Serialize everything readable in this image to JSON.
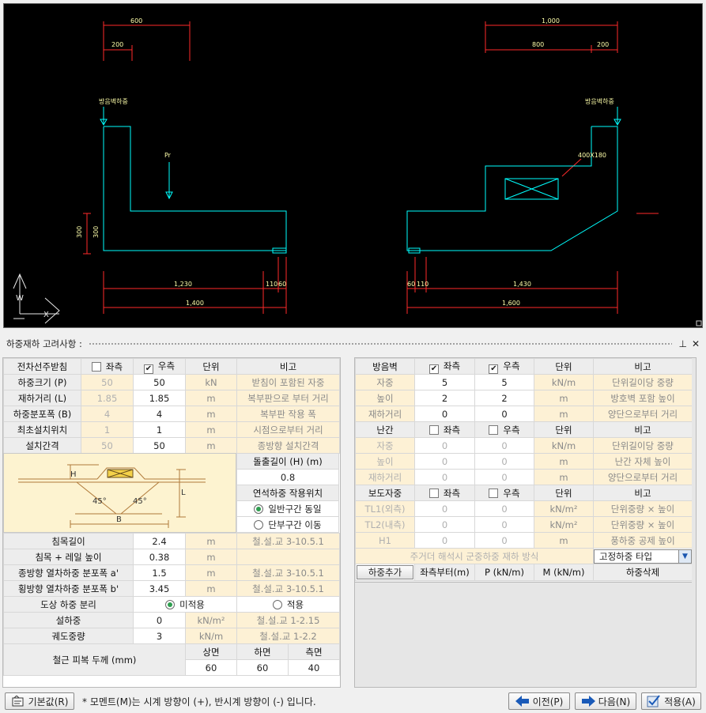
{
  "cad": {
    "left": {
      "dim_top": "600",
      "dim_sub": "200",
      "label_barrier": "방음벽하중",
      "label_pr": "Pr",
      "dim_h1": "300",
      "dim_h2": "300",
      "dim_b1": "1,230",
      "dim_b2": "110",
      "dim_b3": "60",
      "dim_total": "1,400"
    },
    "right": {
      "dim_top": "1,000",
      "dim_sub1": "800",
      "dim_sub2": "200",
      "label_barrier": "방음벽하중",
      "label_box": "400X180",
      "dim_b1": "60",
      "dim_b2": "110",
      "dim_b3": "1,430",
      "dim_total": "1,600"
    },
    "ucs": {
      "x": "X",
      "y": "Y",
      "w": "W"
    }
  },
  "panel": {
    "title": "하중재하 고려사항 :",
    "pin": "📌",
    "close": "✕"
  },
  "left": {
    "header": {
      "c1": "전차선주받침",
      "left": "좌측",
      "right": "우측",
      "unit": "단위",
      "note": "비고"
    },
    "rows": [
      {
        "label": "하중크기 (P)",
        "l": "50",
        "r": "50",
        "unit": "kN",
        "note": "받침이 포함된 자중"
      },
      {
        "label": "재하거리 (L)",
        "l": "1.85",
        "r": "1.85",
        "unit": "m",
        "note": "복부판으로 부터 거리"
      },
      {
        "label": "하중분포폭 (B)",
        "l": "4",
        "r": "4",
        "unit": "m",
        "note": "복부판 작용 폭"
      },
      {
        "label": "최초설치위치",
        "l": "1",
        "r": "1",
        "unit": "m",
        "note": "시점으로부터 거리"
      },
      {
        "label": "설치간격",
        "l": "50",
        "r": "50",
        "unit": "m",
        "note": "종방향 설치간격"
      }
    ],
    "protrusion": {
      "label": "돌출길이 (H) (m)",
      "value": "0.8"
    },
    "position": {
      "label": "연석하중 작용위치",
      "opt1": "일반구간 동일",
      "opt2": "단부구간 이동"
    },
    "diagram": {
      "h": "H",
      "l": "L",
      "b": "B",
      "angle1": "45°",
      "angle2": "45°"
    },
    "rows2": [
      {
        "label": "침목길이",
        "value": "2.4",
        "unit": "m",
        "note": "철.설.교 3-10.5.1"
      },
      {
        "label": "침목 + 레일 높이",
        "value": "0.38",
        "unit": "m",
        "note": ""
      },
      {
        "label": "종방향 열차하중 분포폭 a'",
        "value": "1.5",
        "unit": "m",
        "note": "철.설.교 3-10.5.1"
      },
      {
        "label": "횡방향 열차하중 분포폭 b'",
        "value": "3.45",
        "unit": "m",
        "note": "철.설.교 3-10.5.1"
      }
    ],
    "ballast": {
      "label": "도상 하중 분리",
      "opt1": "미적용",
      "opt2": "적용"
    },
    "rows3": [
      {
        "label": "설하중",
        "value": "0",
        "unit": "kN/m²",
        "note": "철.설.교 1-2.15"
      },
      {
        "label": "궤도중량",
        "value": "3",
        "unit": "kN/m",
        "note": "철.설.교 1-2.2"
      }
    ],
    "cover": {
      "label": "철근 피복 두께 (mm)",
      "top": "상면",
      "bottom": "하면",
      "side": "측면",
      "v_top": "60",
      "v_bottom": "60",
      "v_side": "40"
    }
  },
  "right": {
    "sec1": {
      "title": "방음벽",
      "left": "좌측",
      "right": "우측",
      "unit": "단위",
      "note": "비고"
    },
    "sec1_rows": [
      {
        "label": "자중",
        "l": "5",
        "r": "5",
        "unit": "kN/m",
        "note": "단위길이당 중량"
      },
      {
        "label": "높이",
        "l": "2",
        "r": "2",
        "unit": "m",
        "note": "방호벽 포함 높이"
      },
      {
        "label": "재하거리",
        "l": "0",
        "r": "0",
        "unit": "m",
        "note": "양단으로부터 거리"
      }
    ],
    "sec2": {
      "title": "난간",
      "left": "좌측",
      "right": "우측",
      "unit": "단위",
      "note": "비고"
    },
    "sec2_rows": [
      {
        "label": "자중",
        "l": "0",
        "r": "0",
        "unit": "kN/m",
        "note": "단위길이당 중량"
      },
      {
        "label": "높이",
        "l": "0",
        "r": "0",
        "unit": "m",
        "note": "난간 자체 높이"
      },
      {
        "label": "재하거리",
        "l": "0",
        "r": "0",
        "unit": "m",
        "note": "양단으로부터 거리"
      }
    ],
    "sec3": {
      "title": "보도자중",
      "left": "좌측",
      "right": "우측",
      "unit": "단위",
      "note": "비고"
    },
    "sec3_rows": [
      {
        "label": "TL1(외측)",
        "l": "0",
        "r": "0",
        "unit": "kN/m²",
        "note": "단위중량 × 높이"
      },
      {
        "label": "TL2(내측)",
        "l": "0",
        "r": "0",
        "unit": "kN/m²",
        "note": "단위중량 × 높이"
      },
      {
        "label": "H1",
        "l": "0",
        "r": "0",
        "unit": "m",
        "note": "풍하중 공제 높이"
      }
    ],
    "girder": {
      "label": "주거더 해석시 군중하중 재하 방식",
      "value": "고정하중 타입"
    },
    "load": {
      "add": "하중추가",
      "from_left": "좌측부터(m)",
      "p": "P (kN/m)",
      "m": "M (kN/m)",
      "del": "하중삭제"
    }
  },
  "footer": {
    "default_btn": "기본값(R)",
    "note": "* 모멘트(M)는 시계 방향이 (+), 반시계 방향이 (-) 입니다.",
    "prev_btn": "이전(P)",
    "next_btn": "다음(N)",
    "apply_btn": "적용(A)"
  }
}
